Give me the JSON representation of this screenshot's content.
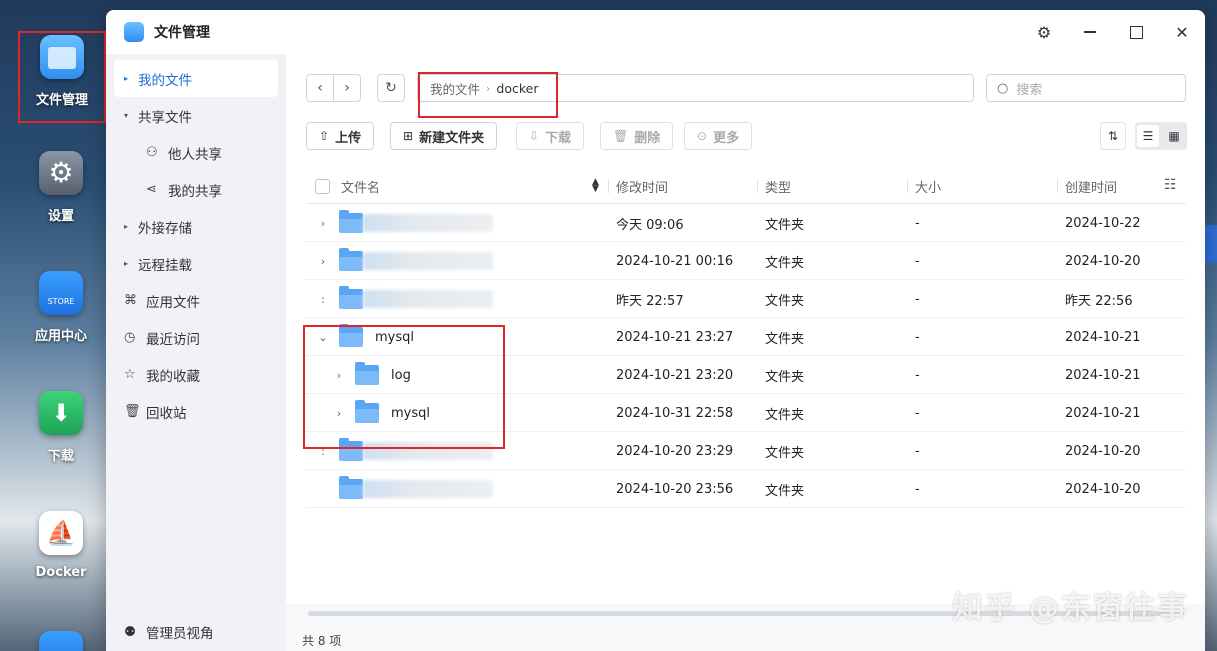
{
  "dock": [
    {
      "label": "文件管理",
      "icon": "folder-app-icon",
      "active": true
    },
    {
      "label": "设置",
      "icon": "gear-app-icon"
    },
    {
      "label": "应用中心",
      "icon": "store-app-icon",
      "sub": "STORE"
    },
    {
      "label": "下载",
      "icon": "download-app-icon"
    },
    {
      "label": "Docker",
      "icon": "docker-app-icon"
    }
  ],
  "window": {
    "title": "文件管理"
  },
  "sidebar": {
    "items": [
      {
        "label": "我的文件",
        "icon": "caret-right",
        "selected": true
      },
      {
        "label": "共享文件",
        "icon": "caret-down"
      },
      {
        "label": "他人共享",
        "icon": "people-icon"
      },
      {
        "label": "我的共享",
        "icon": "share-icon"
      },
      {
        "label": "外接存储",
        "icon": "caret-right"
      },
      {
        "label": "远程挂载",
        "icon": "caret-right"
      },
      {
        "label": "应用文件",
        "icon": "apps-icon"
      },
      {
        "label": "最近访问",
        "icon": "clock-icon"
      },
      {
        "label": "我的收藏",
        "icon": "star-icon"
      },
      {
        "label": "回收站",
        "icon": "trash-icon"
      }
    ],
    "footer": "管理员视角"
  },
  "address": {
    "crumbs": [
      "我的文件",
      "docker"
    ]
  },
  "search": {
    "placeholder": "搜索"
  },
  "toolbar": {
    "upload": "上传",
    "new_folder": "新建文件夹",
    "download": "下载",
    "delete": "删除",
    "more": "更多"
  },
  "table": {
    "headers": {
      "name": "文件名",
      "modified": "修改时间",
      "type": "类型",
      "size": "大小",
      "created": "创建时间"
    },
    "rows": [
      {
        "name": "",
        "blurred": true,
        "level": 0,
        "expand": "›",
        "modified": "今天 09:06",
        "type": "文件夹",
        "size": "-",
        "created": "2024-10-22"
      },
      {
        "name": "",
        "blurred": true,
        "level": 0,
        "expand": "›",
        "modified": "2024-10-21 00:16",
        "type": "文件夹",
        "size": "-",
        "created": "2024-10-20"
      },
      {
        "name": "",
        "blurred": true,
        "level": 0,
        "expand": ":",
        "modified": "昨天 22:57",
        "type": "文件夹",
        "size": "-",
        "created": "昨天 22:56"
      },
      {
        "name": "mysql",
        "blurred": false,
        "level": 0,
        "expand": "⌄",
        "modified": "2024-10-21 23:27",
        "type": "文件夹",
        "size": "-",
        "created": "2024-10-21"
      },
      {
        "name": "log",
        "blurred": false,
        "level": 1,
        "expand": "›",
        "modified": "2024-10-21 23:20",
        "type": "文件夹",
        "size": "-",
        "created": "2024-10-21"
      },
      {
        "name": "mysql",
        "blurred": false,
        "level": 1,
        "expand": "›",
        "modified": "2024-10-31 22:58",
        "type": "文件夹",
        "size": "-",
        "created": "2024-10-21"
      },
      {
        "name": "",
        "blurred": true,
        "level": 0,
        "expand": ":",
        "modified": "2024-10-20 23:29",
        "type": "文件夹",
        "size": "-",
        "created": "2024-10-20"
      },
      {
        "name": "",
        "blurred": true,
        "level": 0,
        "expand": "",
        "modified": "2024-10-20 23:56",
        "type": "文件夹",
        "size": "-",
        "created": "2024-10-20"
      }
    ]
  },
  "status": "共 8 项",
  "watermark": "知乎 @东窗往事",
  "colors": {
    "accent": "#1f6fd0",
    "highlight_box": "#e0262a",
    "folder": "#5aa6f5"
  }
}
